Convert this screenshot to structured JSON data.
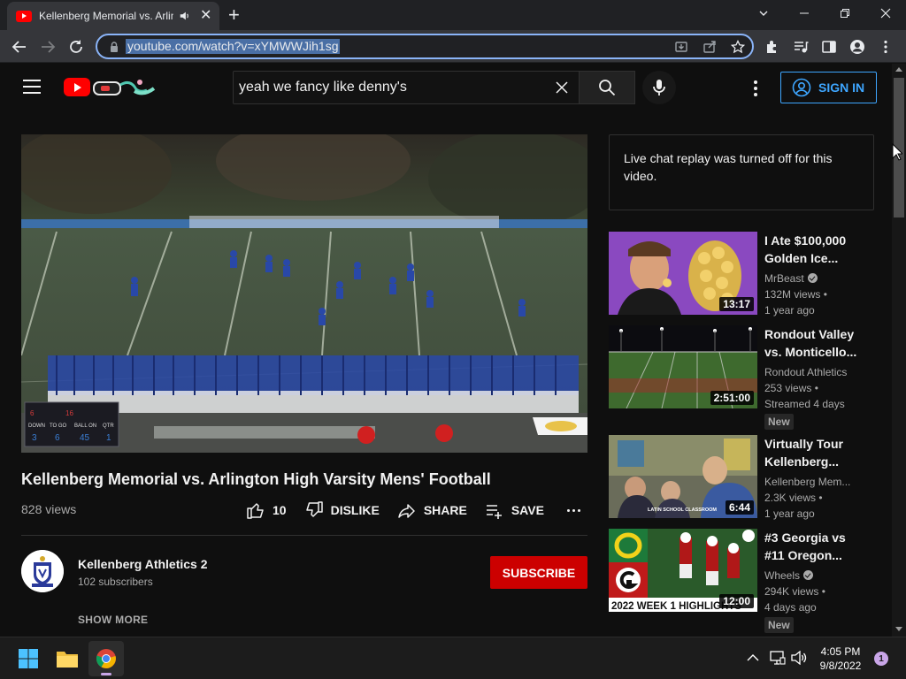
{
  "browser": {
    "tab_title": "Kellenberg Memorial vs. Arlington",
    "address": "youtube.com/watch?v=xYMWWJih1sg"
  },
  "header": {
    "search_query": "yeah we fancy like denny's",
    "sign_in": "SIGN IN"
  },
  "video": {
    "title": "Kellenberg Memorial vs. Arlington High Varsity Mens' Football",
    "views": "828 views",
    "likes": "10",
    "dislike_label": "DISLIKE",
    "share_label": "SHARE",
    "save_label": "SAVE",
    "channel_name": "Kellenberg Athletics 2",
    "subscribers": "102 subscribers",
    "subscribe_label": "SUBSCRIBE",
    "show_more": "SHOW MORE",
    "scoreboard": {
      "down_label": "DOWN",
      "to_go_label": "TO GO",
      "ball_on_label": "BALL ON",
      "qtr_label": "QTR"
    }
  },
  "chat": {
    "message": "Live chat replay was turned off for this video."
  },
  "recommendations": [
    {
      "title_line1": "I Ate $100,000",
      "title_line2": "Golden Ice...",
      "channel": "MrBeast",
      "views": "132M views •",
      "age": "1 year ago",
      "duration": "13:17",
      "badge": "",
      "verified": true
    },
    {
      "title_line1": "Rondout Valley",
      "title_line2": "vs. Monticello...",
      "channel": "Rondout Athletics",
      "views": "253 views •",
      "age": "Streamed 4 days",
      "duration": "2:51:00",
      "badge": "New",
      "verified": false
    },
    {
      "title_line1": "Virtually Tour",
      "title_line2": "Kellenberg...",
      "channel": "Kellenberg Mem...",
      "views": "2.3K views •",
      "age": "1 year ago",
      "duration": "6:44",
      "badge": "",
      "verified": false,
      "thumb_caption": "LATIN SCHOOL CLASSROOM"
    },
    {
      "title_line1": "#3 Georgia vs",
      "title_line2": "#11 Oregon...",
      "channel": "Wheels",
      "views": "294K views •",
      "age": "4 days ago",
      "duration": "12:00",
      "badge": "New",
      "verified": true,
      "thumb_caption": "2022 WEEK 1 HIGHLIGHTS"
    }
  ],
  "taskbar": {
    "time": "4:05 PM",
    "date": "9/8/2022",
    "notifications": "1"
  },
  "colors": {
    "accent_blue": "#3ea6ff",
    "subscribe_red": "#cc0000",
    "yt_red": "#ff0000",
    "background": "#0f0f0f"
  }
}
